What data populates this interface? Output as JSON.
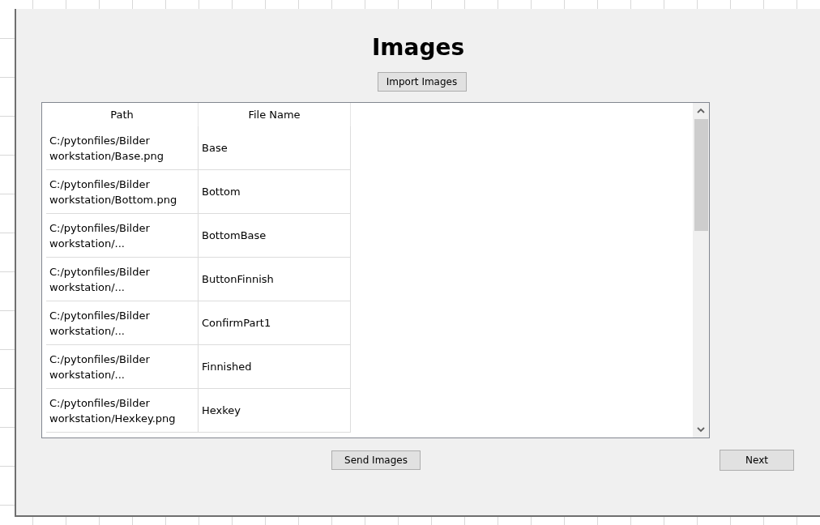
{
  "title": "Images",
  "import_button": "Import Images",
  "table": {
    "columns": [
      "Path",
      "File Name"
    ],
    "rows": [
      {
        "path": "C:/pytonfiles/Bilder workstation/Base.png",
        "file_name": "Base"
      },
      {
        "path": "C:/pytonfiles/Bilder workstation/Bottom.png",
        "file_name": "Bottom"
      },
      {
        "path": "C:/pytonfiles/Bilder workstation/...",
        "file_name": "BottomBase"
      },
      {
        "path": "C:/pytonfiles/Bilder workstation/...",
        "file_name": "ButtonFinnish"
      },
      {
        "path": "C:/pytonfiles/Bilder workstation/...",
        "file_name": "ConfirmPart1"
      },
      {
        "path": "C:/pytonfiles/Bilder workstation/...",
        "file_name": "Finnished"
      },
      {
        "path": "C:/pytonfiles/Bilder workstation/Hexkey.png",
        "file_name": "Hexkey"
      }
    ]
  },
  "send_button": "Send Images",
  "next_button": "Next"
}
